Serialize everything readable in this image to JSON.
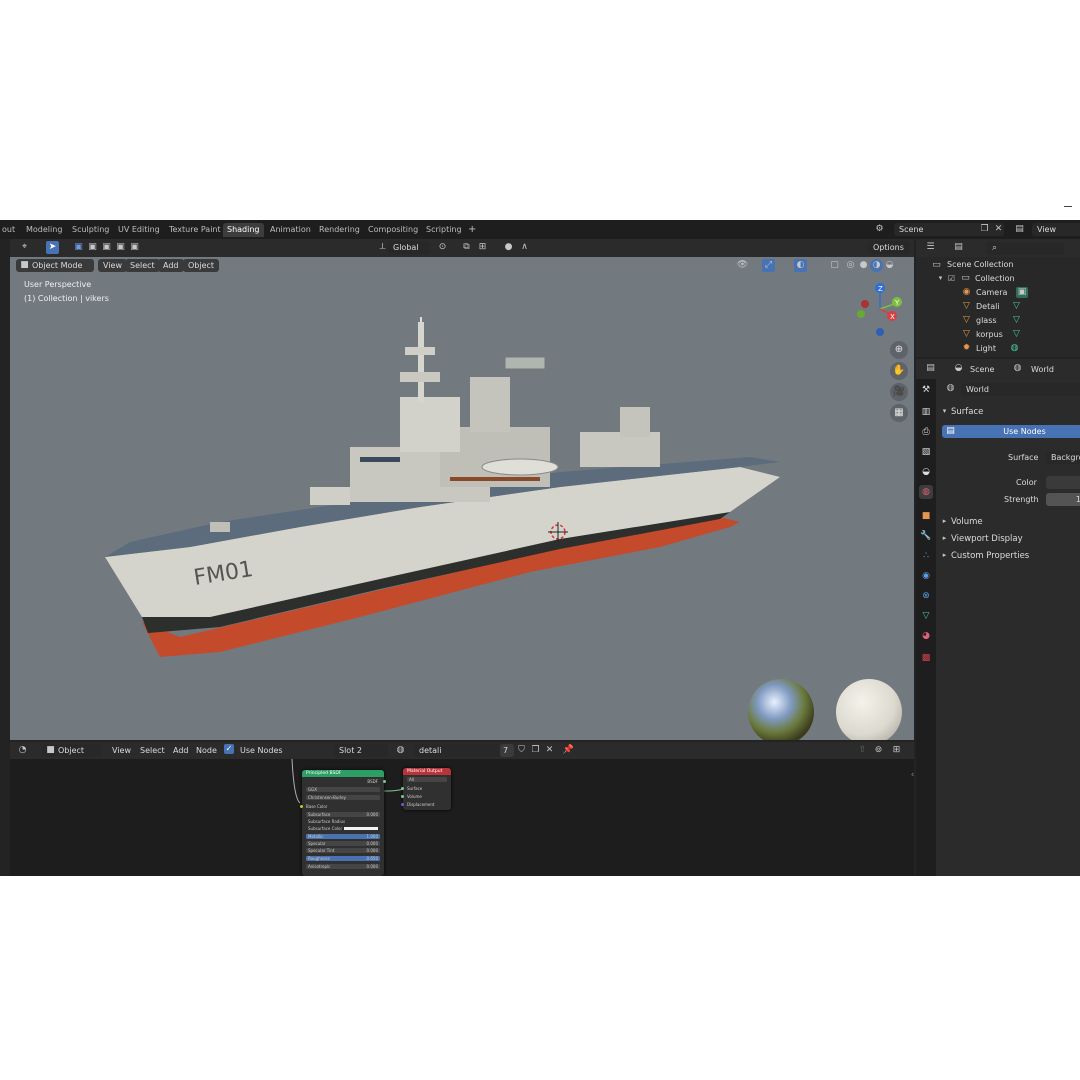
{
  "workspace_tabs": [
    {
      "label": "out"
    },
    {
      "label": "Modeling"
    },
    {
      "label": "Sculpting"
    },
    {
      "label": "UV Editing"
    },
    {
      "label": "Texture Paint"
    },
    {
      "label": "Shading"
    },
    {
      "label": "Animation"
    },
    {
      "label": "Rendering"
    },
    {
      "label": "Compositing"
    },
    {
      "label": "Scripting"
    }
  ],
  "add_workspace": "+",
  "scene_selector": {
    "value": "Scene"
  },
  "view_layer": {
    "value": "View Layer"
  },
  "viewport_header": {
    "transform_orientation": "Global",
    "options_label": "Options",
    "mode": "Object Mode",
    "menus": [
      "View",
      "Select",
      "Add",
      "Object"
    ]
  },
  "viewport": {
    "perspective_label": "User Perspective",
    "collection_label": "(1) Collection | vikers",
    "hull_text": "FM01"
  },
  "node_editor": {
    "editor_type": "Object",
    "menus": [
      "View",
      "Select",
      "Add",
      "Node"
    ],
    "use_nodes_label": "Use Nodes",
    "slot": "Slot 2",
    "material_name": "detali",
    "users_count": "7",
    "bsdf_node": {
      "title": "Principled BSDF",
      "output": "BSDF",
      "distribution": "GGX",
      "subsurface_method": "Christensen-Burley",
      "rows": [
        {
          "label": "Base Color",
          "value": ""
        },
        {
          "label": "Subsurface",
          "value": "0.000"
        },
        {
          "label": "Subsurface Radius",
          "value": ""
        },
        {
          "label": "Subsurface Color",
          "value": ""
        },
        {
          "label": "Metallic",
          "value": "1.000"
        },
        {
          "label": "Specular",
          "value": "0.000"
        },
        {
          "label": "Specular Tint",
          "value": "0.000"
        },
        {
          "label": "Roughness",
          "value": "0.650"
        },
        {
          "label": "Anisotropic",
          "value": "0.000"
        }
      ]
    },
    "output_node": {
      "title": "Material Output",
      "target": "All",
      "inputs": [
        "Surface",
        "Volume",
        "Displacement"
      ]
    }
  },
  "outliner": {
    "root": "Scene Collection",
    "collection": "Collection",
    "items": [
      {
        "label": "Camera",
        "icon": "camera-icon",
        "color": "#e5974f"
      },
      {
        "label": "Detali",
        "icon": "mesh-icon",
        "color": "#e5974f"
      },
      {
        "label": "glass",
        "icon": "mesh-icon",
        "color": "#e5974f"
      },
      {
        "label": "korpus",
        "icon": "mesh-icon",
        "color": "#e5974f"
      },
      {
        "label": "Light",
        "icon": "light-icon",
        "color": "#e5974f"
      }
    ]
  },
  "properties": {
    "context_scene": "Scene",
    "context_world": "World",
    "world_name": "World",
    "surface_panel": "Surface",
    "use_nodes_button": "Use Nodes",
    "surface_label": "Surface",
    "surface_value": "Backgro",
    "color_label": "Color",
    "strength_label": "Strength",
    "strength_value": "1",
    "panels": [
      "Volume",
      "Viewport Display",
      "Custom Properties"
    ]
  },
  "colors": {
    "accent_blue": "#4772b3",
    "node_bsdf_header": "#2d9f66",
    "node_output_header": "#b8343a",
    "viewport_bg": "#727a80",
    "hull_red": "#c44a2c",
    "hull_white": "#d8d8d0"
  }
}
